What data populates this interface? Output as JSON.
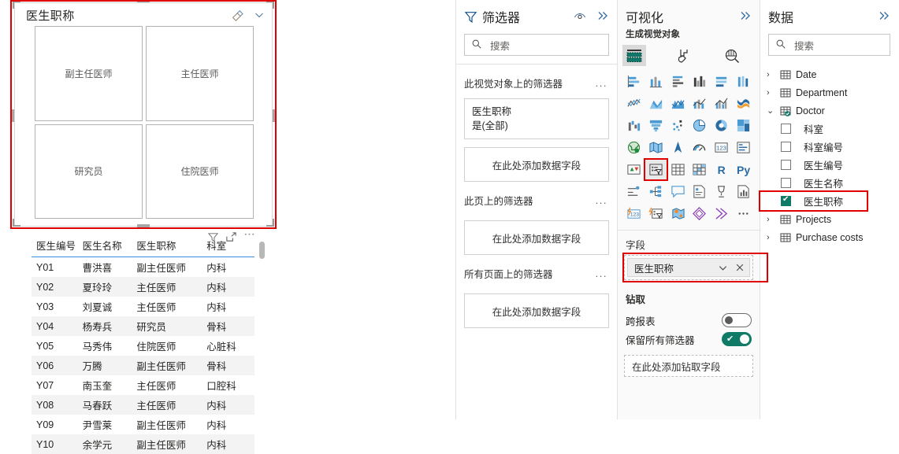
{
  "canvas": {
    "slicer": {
      "title": "医生职称",
      "icons": [
        {
          "name": "eraser-icon",
          "label": "清除选择"
        },
        {
          "name": "chevron-down-icon",
          "label": "展开"
        }
      ],
      "tiles": [
        "副主任医师",
        "主任医师",
        "研究员",
        "住院医师"
      ],
      "selection_color": "#e00000"
    },
    "table": {
      "headers": [
        "医生编号",
        "医生名称",
        "医生职称",
        "科室"
      ],
      "header_underline_color": "#3a8dde",
      "icons": [
        {
          "name": "filter-icon",
          "label": "筛选器"
        },
        {
          "name": "focus-mode-icon",
          "label": "焦点模式"
        },
        {
          "name": "more-options-icon",
          "label": "更多选项"
        }
      ],
      "rows": [
        [
          "Y01",
          "曹洪喜",
          "副主任医师",
          "内科"
        ],
        [
          "Y02",
          "夏玲玲",
          "主任医师",
          "内科"
        ],
        [
          "Y03",
          "刘夏诚",
          "主任医师",
          "内科"
        ],
        [
          "Y04",
          "杨寿兵",
          "研究员",
          "骨科"
        ],
        [
          "Y05",
          "马秀伟",
          "住院医师",
          "心脏科"
        ],
        [
          "Y06",
          "万腾",
          "副主任医师",
          "骨科"
        ],
        [
          "Y07",
          "南玉奎",
          "主任医师",
          "口腔科"
        ],
        [
          "Y08",
          "马春跃",
          "主任医师",
          "内科"
        ],
        [
          "Y09",
          "尹雪莱",
          "副主任医师",
          "内科"
        ],
        [
          "Y10",
          "余学元",
          "副主任医师",
          "内科"
        ]
      ]
    }
  },
  "filters": {
    "title": "筛选器",
    "header_icons": [
      {
        "name": "eye-icon",
        "label": "显示/隐藏"
      },
      {
        "name": "collapse-icon",
        "label": "折叠窗格"
      }
    ],
    "search": {
      "placeholder": "搜索",
      "value": ""
    },
    "sections": [
      {
        "label": "此视觉对象上的筛选器",
        "more": "...",
        "cards": [
          {
            "field": "医生职称",
            "state": "是(全部)"
          }
        ],
        "dropzone": "在此处添加数据字段"
      },
      {
        "label": "此页上的筛选器",
        "more": "...",
        "cards": [],
        "dropzone": "在此处添加数据字段"
      },
      {
        "label": "所有页面上的筛选器",
        "more": "...",
        "cards": [],
        "dropzone": "在此处添加数据字段"
      }
    ]
  },
  "visualizations": {
    "title": "可视化",
    "collapse_icon": "collapse-icon",
    "subtitle": "生成视觉对象",
    "tabs": [
      {
        "name": "build-visual-tab",
        "label": "生成视觉对象",
        "selected": true
      },
      {
        "name": "format-visual-tab",
        "label": "设置视觉对象格式",
        "selected": false
      },
      {
        "name": "analytics-tab",
        "label": "分析",
        "selected": false
      }
    ],
    "visual_types": [
      {
        "name": "stacked-bar-chart",
        "label": "堆积条形图",
        "selected": false
      },
      {
        "name": "stacked-column-chart",
        "label": "堆积柱形图",
        "selected": false
      },
      {
        "name": "clustered-bar-chart",
        "label": "簇状条形图",
        "selected": false
      },
      {
        "name": "clustered-column-chart",
        "label": "簇状柱形图",
        "selected": false
      },
      {
        "name": "100-stacked-bar-chart",
        "label": "百分比堆积条形图",
        "selected": false
      },
      {
        "name": "100-stacked-column-chart",
        "label": "百分比堆积柱形图",
        "selected": false
      },
      {
        "name": "line-chart",
        "label": "折线图",
        "selected": false
      },
      {
        "name": "area-chart",
        "label": "面积图",
        "selected": false
      },
      {
        "name": "stacked-area-chart",
        "label": "堆积面积图",
        "selected": false
      },
      {
        "name": "line-stacked-column-chart",
        "label": "折线和堆积柱形图",
        "selected": false
      },
      {
        "name": "line-clustered-column-chart",
        "label": "折线和簇状柱形图",
        "selected": false
      },
      {
        "name": "ribbon-chart",
        "label": "功能区图表",
        "selected": false
      },
      {
        "name": "waterfall-chart",
        "label": "瀑布图",
        "selected": false
      },
      {
        "name": "funnel-chart",
        "label": "漏斗图",
        "selected": false
      },
      {
        "name": "scatter-chart",
        "label": "散点图",
        "selected": false
      },
      {
        "name": "pie-chart",
        "label": "饼图",
        "selected": false
      },
      {
        "name": "donut-chart",
        "label": "环形图",
        "selected": false
      },
      {
        "name": "treemap",
        "label": "树状图",
        "selected": false
      },
      {
        "name": "map",
        "label": "地图",
        "selected": false
      },
      {
        "name": "filled-map",
        "label": "着色地图",
        "selected": false
      },
      {
        "name": "shape-map",
        "label": "形状图",
        "selected": false
      },
      {
        "name": "gauge",
        "label": "仪表",
        "selected": false
      },
      {
        "name": "card",
        "label": "卡片图",
        "selected": false
      },
      {
        "name": "multi-row-card",
        "label": "多行卡",
        "selected": false
      },
      {
        "name": "kpi",
        "label": "KPI",
        "selected": false
      },
      {
        "name": "slicer",
        "label": "切片器",
        "selected": true
      },
      {
        "name": "table",
        "label": "表",
        "selected": false
      },
      {
        "name": "matrix",
        "label": "矩阵",
        "selected": false
      },
      {
        "name": "r-visual",
        "label": "R",
        "selected": false
      },
      {
        "name": "python-visual",
        "label": "Py",
        "selected": false
      },
      {
        "name": "key-influencers",
        "label": "关键影响因素",
        "selected": false
      },
      {
        "name": "decomposition-tree",
        "label": "分解树",
        "selected": false
      },
      {
        "name": "qa-visual",
        "label": "问答",
        "selected": false
      },
      {
        "name": "narrative",
        "label": "智能叙述",
        "selected": false
      },
      {
        "name": "metrics",
        "label": "指标",
        "selected": false
      },
      {
        "name": "paginated-report",
        "label": "分页报表",
        "selected": false
      },
      {
        "name": "power-apps",
        "label": "Power Apps",
        "selected": false
      },
      {
        "name": "power-automate",
        "label": "Power Automate",
        "selected": false
      },
      {
        "name": "arcgis-maps",
        "label": "ArcGIS Maps",
        "selected": false
      },
      {
        "name": "visio-visual",
        "label": "Visio",
        "selected": false
      },
      {
        "name": "stream-visual",
        "label": "Stream",
        "selected": false
      },
      {
        "name": "more-visuals",
        "label": "...",
        "selected": false
      }
    ],
    "fields": {
      "label": "字段",
      "chip": {
        "name": "医生职称",
        "has_chevron": true,
        "has_remove": true
      },
      "highlight_color": "#e00000"
    },
    "drill": {
      "label": "钻取",
      "rows": [
        {
          "label": "跨报表",
          "state": "off"
        },
        {
          "label": "保留所有筛选器",
          "state": "on"
        }
      ],
      "dropzone": "在此处添加钻取字段",
      "toggle_on_color": "#0f7a66"
    }
  },
  "data": {
    "title": "数据",
    "collapse_icon": "collapse-icon",
    "search": {
      "placeholder": "搜索",
      "value": ""
    },
    "tables": [
      {
        "name": "Date",
        "expanded": false,
        "fields": []
      },
      {
        "name": "Department",
        "expanded": false,
        "fields": []
      },
      {
        "name": "Doctor",
        "expanded": true,
        "badge": "in-use",
        "fields": [
          {
            "name": "科室",
            "checked": false,
            "highlighted": false
          },
          {
            "name": "科室编号",
            "checked": false,
            "highlighted": false
          },
          {
            "name": "医生编号",
            "checked": false,
            "highlighted": false
          },
          {
            "name": "医生名称",
            "checked": false,
            "highlighted": false
          },
          {
            "name": "医生职称",
            "checked": true,
            "highlighted": true
          }
        ]
      },
      {
        "name": "Projects",
        "expanded": false,
        "fields": []
      },
      {
        "name": "Purchase costs",
        "expanded": false,
        "fields": []
      }
    ]
  }
}
